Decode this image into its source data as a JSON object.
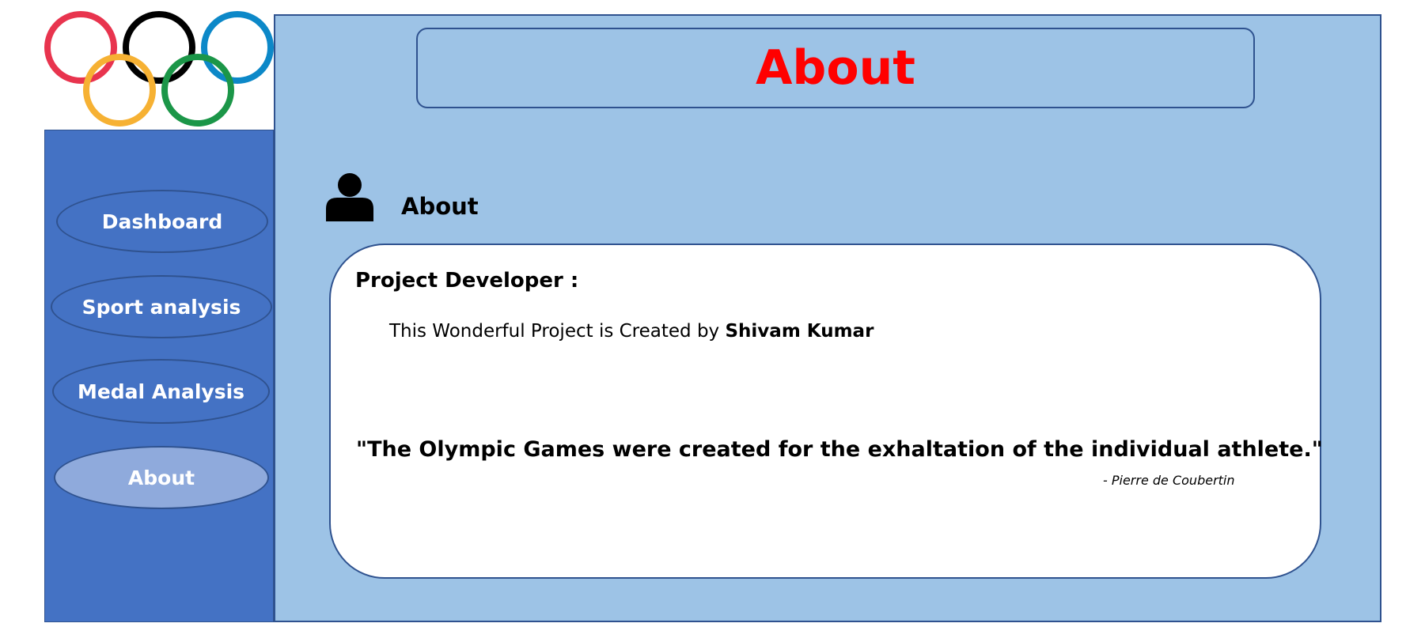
{
  "header": {
    "title": "About"
  },
  "logo": {
    "icon": "olympic-rings-icon",
    "ring_colors": [
      "#e8344e",
      "#000000",
      "#0c88c8",
      "#f6b133",
      "#1b9648"
    ]
  },
  "sidebar": {
    "items": [
      {
        "label": "Dashboard",
        "active": false
      },
      {
        "label": "Sport analysis",
        "active": false
      },
      {
        "label": "Medal Analysis",
        "active": false
      },
      {
        "label": "About",
        "active": true
      }
    ]
  },
  "section": {
    "icon": "user-icon",
    "heading": "About"
  },
  "card": {
    "developer_label": "Project Developer :",
    "credit_prefix": "This Wonderful Project is Created by ",
    "credit_name": "Shivam Kumar",
    "quote": "\"The Olympic Games were created for the exhaltation of the individual athlete.\"",
    "attribution": "- Pierre de Coubertin"
  },
  "colors": {
    "sidebar_bg": "#4472c4",
    "main_bg": "#9dc3e6",
    "border": "#2f528f",
    "active_nav": "#8faadc",
    "title_red": "#ff0000"
  }
}
